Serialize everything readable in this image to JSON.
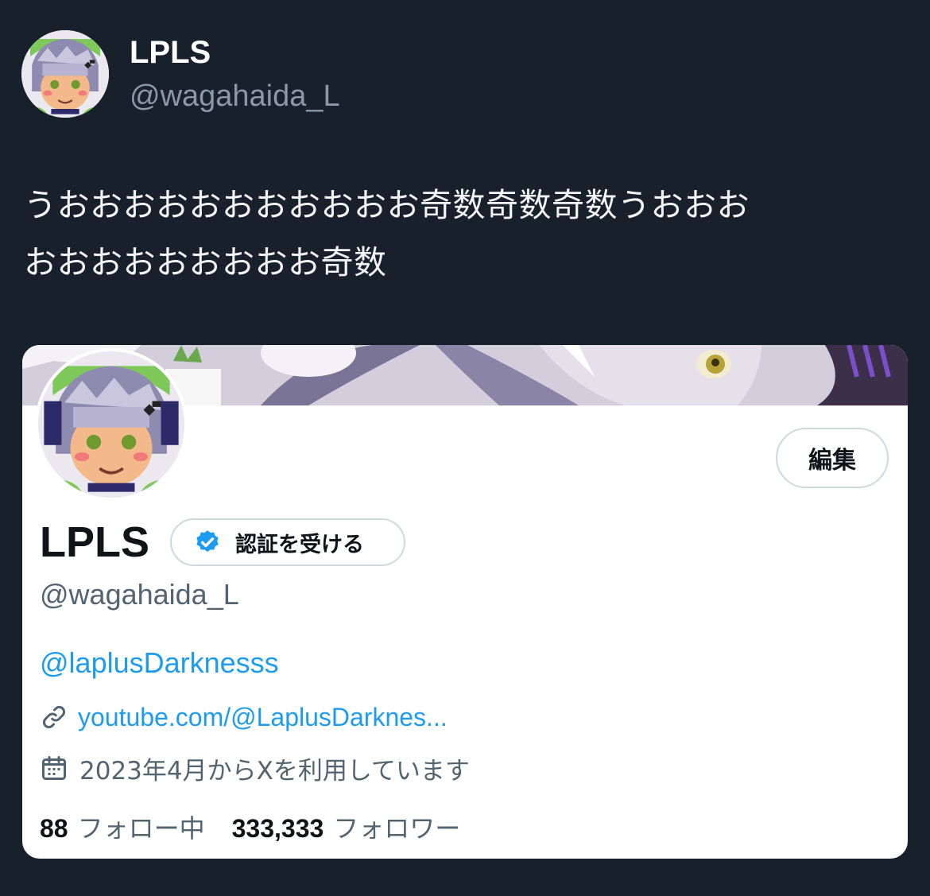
{
  "author": {
    "name": "LPLS",
    "handle": "@wagahaida_L"
  },
  "tweet": {
    "line1": "うおおおおおおおおおおお奇数奇数奇数うおおお",
    "line2": "おおおおおおおおお奇数"
  },
  "profile_card": {
    "edit_label": "編集",
    "name": "LPLS",
    "verify_label": "認証を受ける",
    "handle": "@wagahaida_L",
    "bio_mention": "@laplusDarknesss",
    "url": "youtube.com/@LaplusDarknes...",
    "joined": "2023年4月からXを利用しています",
    "following_count": "88",
    "following_label": "フォロー中",
    "followers_count": "333,333",
    "followers_label": "フォロワー"
  },
  "icons": {
    "verified": "verified-badge-icon",
    "link": "link-icon",
    "calendar": "calendar-icon"
  },
  "colors": {
    "background": "#18202b",
    "link": "#1d9bf0",
    "verified": "#1d9bf0"
  }
}
